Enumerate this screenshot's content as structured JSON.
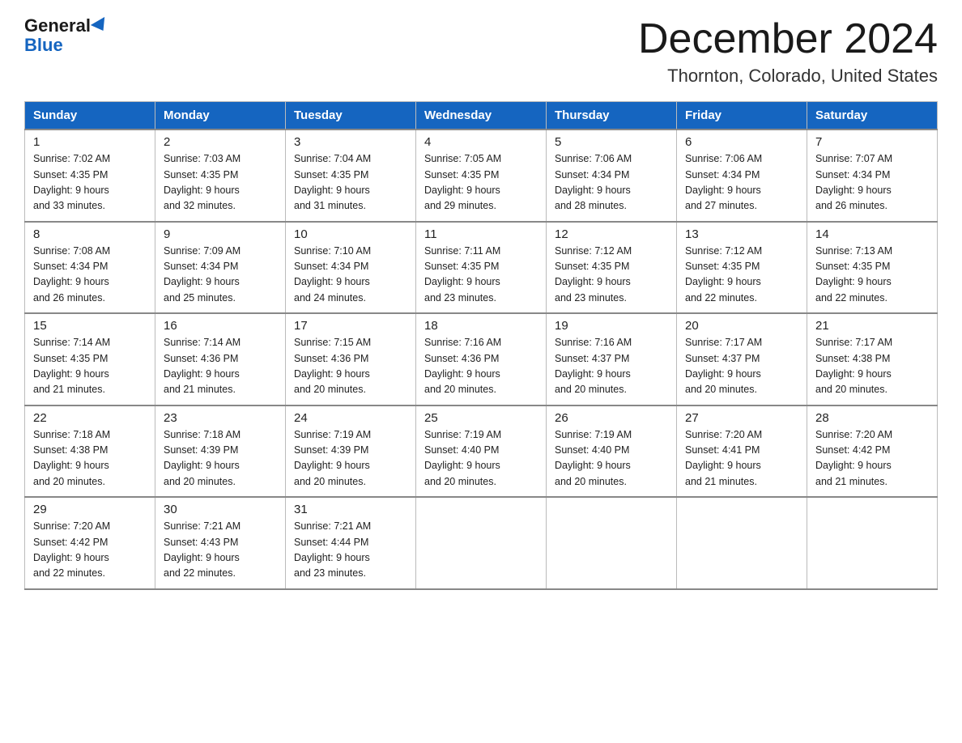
{
  "header": {
    "logo_general": "General",
    "logo_blue": "Blue",
    "month_title": "December 2024",
    "location": "Thornton, Colorado, United States"
  },
  "weekdays": [
    "Sunday",
    "Monday",
    "Tuesday",
    "Wednesday",
    "Thursday",
    "Friday",
    "Saturday"
  ],
  "weeks": [
    [
      {
        "day": "1",
        "sunrise": "7:02 AM",
        "sunset": "4:35 PM",
        "daylight": "9 hours and 33 minutes."
      },
      {
        "day": "2",
        "sunrise": "7:03 AM",
        "sunset": "4:35 PM",
        "daylight": "9 hours and 32 minutes."
      },
      {
        "day": "3",
        "sunrise": "7:04 AM",
        "sunset": "4:35 PM",
        "daylight": "9 hours and 31 minutes."
      },
      {
        "day": "4",
        "sunrise": "7:05 AM",
        "sunset": "4:35 PM",
        "daylight": "9 hours and 29 minutes."
      },
      {
        "day": "5",
        "sunrise": "7:06 AM",
        "sunset": "4:34 PM",
        "daylight": "9 hours and 28 minutes."
      },
      {
        "day": "6",
        "sunrise": "7:06 AM",
        "sunset": "4:34 PM",
        "daylight": "9 hours and 27 minutes."
      },
      {
        "day": "7",
        "sunrise": "7:07 AM",
        "sunset": "4:34 PM",
        "daylight": "9 hours and 26 minutes."
      }
    ],
    [
      {
        "day": "8",
        "sunrise": "7:08 AM",
        "sunset": "4:34 PM",
        "daylight": "9 hours and 26 minutes."
      },
      {
        "day": "9",
        "sunrise": "7:09 AM",
        "sunset": "4:34 PM",
        "daylight": "9 hours and 25 minutes."
      },
      {
        "day": "10",
        "sunrise": "7:10 AM",
        "sunset": "4:34 PM",
        "daylight": "9 hours and 24 minutes."
      },
      {
        "day": "11",
        "sunrise": "7:11 AM",
        "sunset": "4:35 PM",
        "daylight": "9 hours and 23 minutes."
      },
      {
        "day": "12",
        "sunrise": "7:12 AM",
        "sunset": "4:35 PM",
        "daylight": "9 hours and 23 minutes."
      },
      {
        "day": "13",
        "sunrise": "7:12 AM",
        "sunset": "4:35 PM",
        "daylight": "9 hours and 22 minutes."
      },
      {
        "day": "14",
        "sunrise": "7:13 AM",
        "sunset": "4:35 PM",
        "daylight": "9 hours and 22 minutes."
      }
    ],
    [
      {
        "day": "15",
        "sunrise": "7:14 AM",
        "sunset": "4:35 PM",
        "daylight": "9 hours and 21 minutes."
      },
      {
        "day": "16",
        "sunrise": "7:14 AM",
        "sunset": "4:36 PM",
        "daylight": "9 hours and 21 minutes."
      },
      {
        "day": "17",
        "sunrise": "7:15 AM",
        "sunset": "4:36 PM",
        "daylight": "9 hours and 20 minutes."
      },
      {
        "day": "18",
        "sunrise": "7:16 AM",
        "sunset": "4:36 PM",
        "daylight": "9 hours and 20 minutes."
      },
      {
        "day": "19",
        "sunrise": "7:16 AM",
        "sunset": "4:37 PM",
        "daylight": "9 hours and 20 minutes."
      },
      {
        "day": "20",
        "sunrise": "7:17 AM",
        "sunset": "4:37 PM",
        "daylight": "9 hours and 20 minutes."
      },
      {
        "day": "21",
        "sunrise": "7:17 AM",
        "sunset": "4:38 PM",
        "daylight": "9 hours and 20 minutes."
      }
    ],
    [
      {
        "day": "22",
        "sunrise": "7:18 AM",
        "sunset": "4:38 PM",
        "daylight": "9 hours and 20 minutes."
      },
      {
        "day": "23",
        "sunrise": "7:18 AM",
        "sunset": "4:39 PM",
        "daylight": "9 hours and 20 minutes."
      },
      {
        "day": "24",
        "sunrise": "7:19 AM",
        "sunset": "4:39 PM",
        "daylight": "9 hours and 20 minutes."
      },
      {
        "day": "25",
        "sunrise": "7:19 AM",
        "sunset": "4:40 PM",
        "daylight": "9 hours and 20 minutes."
      },
      {
        "day": "26",
        "sunrise": "7:19 AM",
        "sunset": "4:40 PM",
        "daylight": "9 hours and 20 minutes."
      },
      {
        "day": "27",
        "sunrise": "7:20 AM",
        "sunset": "4:41 PM",
        "daylight": "9 hours and 21 minutes."
      },
      {
        "day": "28",
        "sunrise": "7:20 AM",
        "sunset": "4:42 PM",
        "daylight": "9 hours and 21 minutes."
      }
    ],
    [
      {
        "day": "29",
        "sunrise": "7:20 AM",
        "sunset": "4:42 PM",
        "daylight": "9 hours and 22 minutes."
      },
      {
        "day": "30",
        "sunrise": "7:21 AM",
        "sunset": "4:43 PM",
        "daylight": "9 hours and 22 minutes."
      },
      {
        "day": "31",
        "sunrise": "7:21 AM",
        "sunset": "4:44 PM",
        "daylight": "9 hours and 23 minutes."
      },
      null,
      null,
      null,
      null
    ]
  ],
  "labels": {
    "sunrise": "Sunrise:",
    "sunset": "Sunset:",
    "daylight": "Daylight:"
  }
}
